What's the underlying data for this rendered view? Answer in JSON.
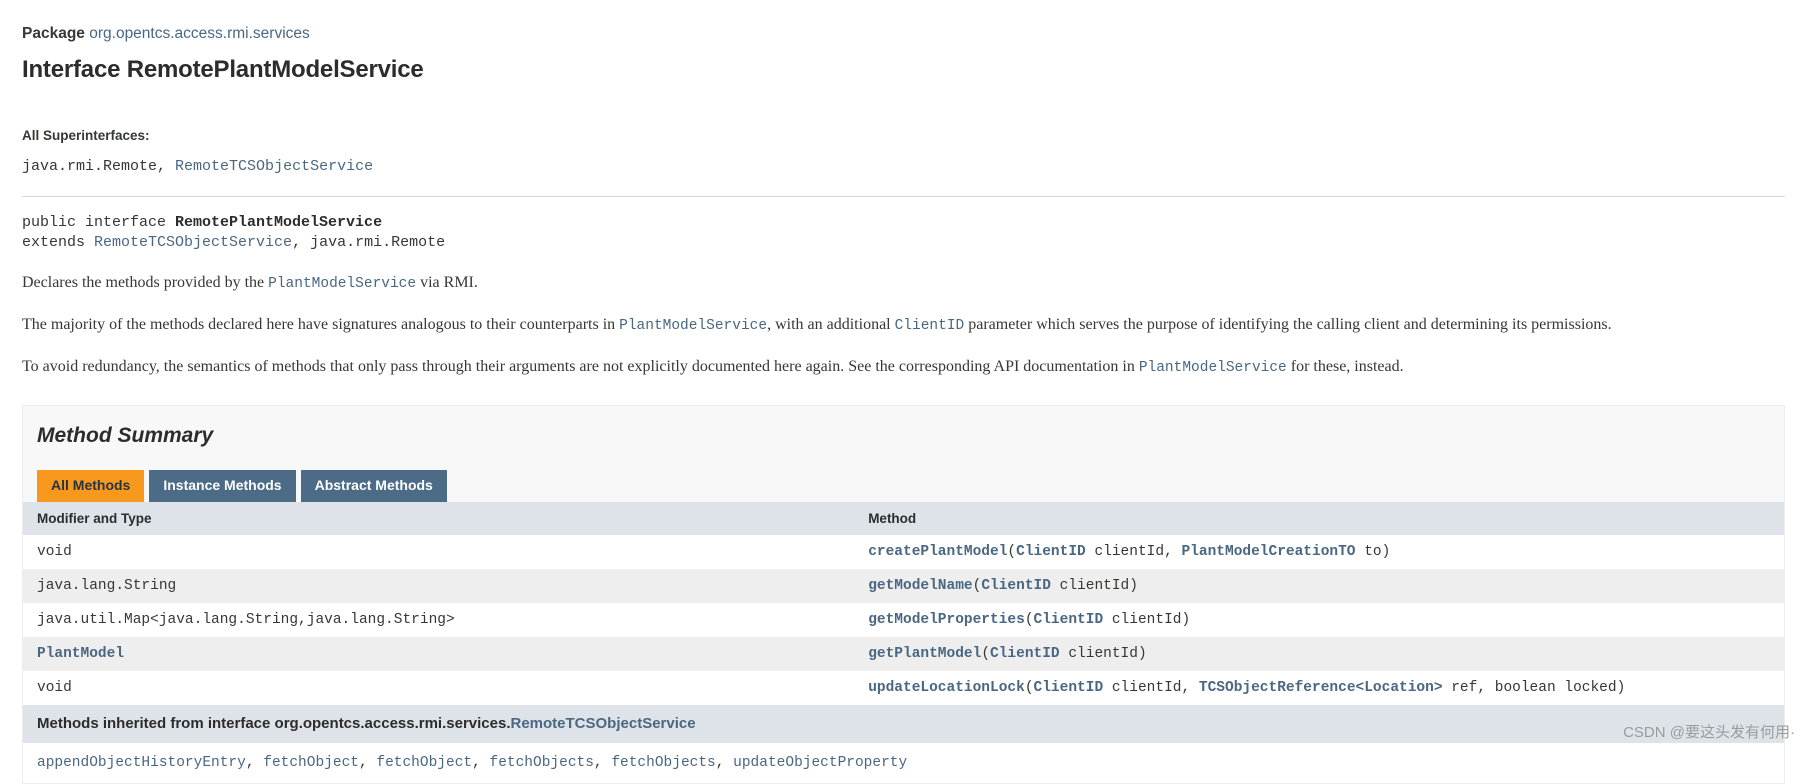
{
  "header": {
    "package_label": "Package",
    "package_name": "org.opentcs.access.rmi.services",
    "title": "Interface RemotePlantModelService"
  },
  "superinterfaces": {
    "label": "All Superinterfaces:",
    "prefix": "java.rmi.Remote,",
    "link": "RemoteTCSObjectService"
  },
  "declaration": {
    "line1_prefix": "public interface ",
    "line1_name": "RemotePlantModelService",
    "line2_prefix": "extends ",
    "line2_link": "RemoteTCSObjectService",
    "line2_suffix": ", java.rmi.Remote"
  },
  "paragraphs": {
    "p1_a": "Declares the methods provided by the ",
    "p1_link": "PlantModelService",
    "p1_b": " via RMI.",
    "p2_a": "The majority of the methods declared here have signatures analogous to their counterparts in ",
    "p2_link1": "PlantModelService",
    "p2_b": ", with an additional ",
    "p2_link2": "ClientID",
    "p2_c": " parameter which serves the purpose of identifying the calling client and determining its permissions.",
    "p3_a": "To avoid redundancy, the semantics of methods that only pass through their arguments are not explicitly documented here again. See the corresponding API documentation in ",
    "p3_link": "PlantModelService",
    "p3_b": " for these, instead."
  },
  "method_summary": {
    "heading": "Method Summary",
    "tabs": [
      {
        "label": "All Methods",
        "active": true
      },
      {
        "label": "Instance Methods",
        "active": false
      },
      {
        "label": "Abstract Methods",
        "active": false
      }
    ],
    "columns": {
      "modifier_and_type": "Modifier and Type",
      "method": "Method"
    },
    "rows": [
      {
        "type_plain": "void",
        "type_link": "",
        "name": "createPlantModel",
        "open": "(",
        "params": [
          {
            "type": "ClientID",
            "is_link": true,
            "name": " clientId"
          },
          {
            "type": "PlantModelCreationTO",
            "is_link": true,
            "name": " to"
          }
        ],
        "close": ")"
      },
      {
        "type_plain": "java.lang.String",
        "type_link": "",
        "name": "getModelName",
        "open": "(",
        "params": [
          {
            "type": "ClientID",
            "is_link": true,
            "name": " clientId"
          }
        ],
        "close": ")"
      },
      {
        "type_plain": "java.util.Map<java.lang.String,java.lang.String>",
        "type_link": "",
        "name": "getModelProperties",
        "open": "(",
        "params": [
          {
            "type": "ClientID",
            "is_link": true,
            "name": " clientId"
          }
        ],
        "close": ")"
      },
      {
        "type_plain": "",
        "type_link": "PlantModel",
        "name": "getPlantModel",
        "open": "(",
        "params": [
          {
            "type": "ClientID",
            "is_link": true,
            "name": " clientId"
          }
        ],
        "close": ")"
      },
      {
        "type_plain": "void",
        "type_link": "",
        "name": "updateLocationLock",
        "open": "(",
        "params": [
          {
            "type": "ClientID",
            "is_link": true,
            "name": " clientId"
          },
          {
            "type": "TCSObjectReference<Location>",
            "is_link": true,
            "name": " ref"
          },
          {
            "type": "",
            "is_link": false,
            "name": "boolean locked"
          }
        ],
        "close": ")"
      }
    ]
  },
  "inherited": {
    "title_prefix": "Methods inherited from interface org.opentcs.access.rmi.services.",
    "title_link": "RemoteTCSObjectService",
    "methods": [
      "appendObjectHistoryEntry",
      "fetchObject",
      "fetchObject",
      "fetchObjects",
      "fetchObjects",
      "updateObjectProperty"
    ]
  },
  "watermark": "CSDN @要这头发有何用·"
}
